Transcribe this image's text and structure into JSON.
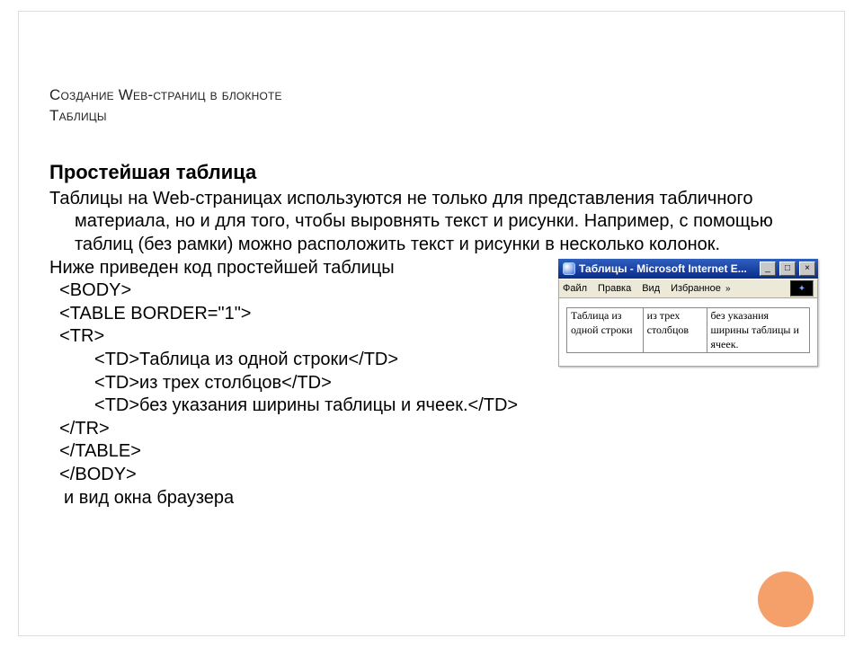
{
  "title_line1": "Создание Web-страниц в блокноте",
  "title_line2": "Таблицы",
  "subheading": "Простейшая таблица",
  "para1": "Таблицы на Web-страницах используются не только для представления табличного материала, но и для того, чтобы выровнять текст и рисунки. Например, с помощью таблиц (без рамки) можно расположить текст и рисунки в несколько колонок.",
  "para2": "Ниже приведен код простейшей таблицы",
  "code": {
    "l1": "  <BODY>",
    "l2": "  <TABLE BORDER=\"1\">",
    "l3": "  <TR>",
    "l4": "         <TD>Таблица из одной строки</TD>",
    "l5": "         <TD>из трех столбцов</TD>",
    "l6": "         <TD>без указания ширины таблицы и ячеек.</TD>",
    "l7": "  </TR>",
    "l8": "  </TABLE>",
    "l9": "  </BODY>"
  },
  "footer": "и вид окна браузера",
  "browser": {
    "title": "Таблицы - Microsoft Internet E...",
    "min": "_",
    "max": "□",
    "close": "×",
    "menu": {
      "file": "Файл",
      "edit": "Правка",
      "view": "Вид",
      "fav": "Избранное",
      "chev": "»"
    },
    "cells": {
      "c1": "Таблица из одной строки",
      "c2": "из трех столбцов",
      "c3": "без указания ширины таблицы и ячеек."
    }
  }
}
